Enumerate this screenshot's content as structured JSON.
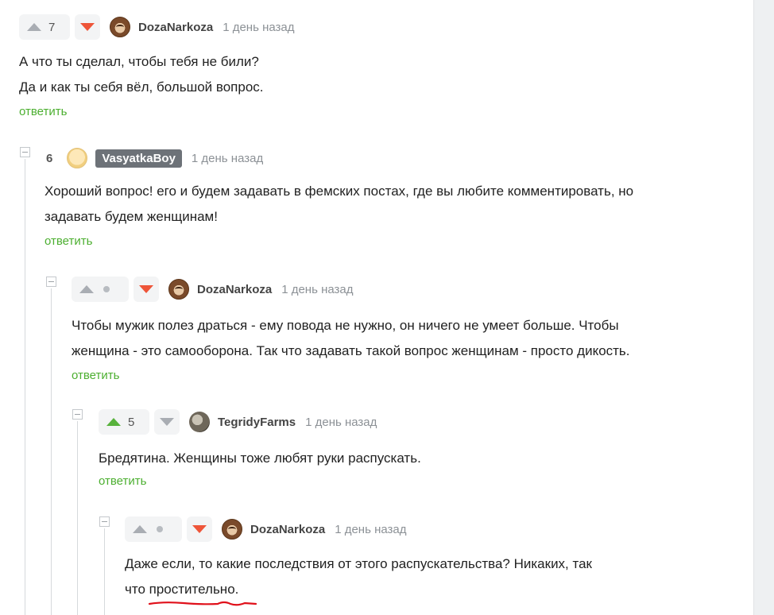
{
  "comments": [
    {
      "author": "DozaNarkoza",
      "time": "1 день назад",
      "rating": "7",
      "lines": [
        "А что ты сделал, чтобы тебя не били?",
        "Да и как ты себя вёл, большой вопрос."
      ],
      "reply": "ответить"
    },
    {
      "author": "VasyatkaBoy",
      "time": "1 день назад",
      "rating": "6",
      "lines": [
        "Хороший вопрос! его и будем задавать в фемских постах, где вы любите комментировать, но",
        "задавать будем женщинам!"
      ],
      "reply": "ответить"
    },
    {
      "author": "DozaNarkoza",
      "time": "1 день назад",
      "rating": "",
      "lines": [
        "Чтобы мужик полез драться - ему повода не нужно, он ничего не умеет больше. Чтобы",
        "женщина - это самооборона. Так что задавать такой вопрос женщинам - просто дикость."
      ],
      "reply": "ответить"
    },
    {
      "author": "TegridyFarms",
      "time": "1 день назад",
      "rating": "5",
      "lines": [
        "Бредятина. Женщины тоже любят руки распускать."
      ],
      "reply": "ответить"
    },
    {
      "author": "DozaNarkoza",
      "time": "1 день назад",
      "rating": "",
      "lines": [
        "Даже если, то какие последствия от этого распускательства? Никаких, так"
      ],
      "line2_prefix": "что ",
      "line2_underlined": "простительно."
    }
  ],
  "colors": {
    "upvote_active": "#58b23c",
    "downvote_active": "#ee5539",
    "reply_link": "#4caf30",
    "annotation": "#e0101a"
  }
}
